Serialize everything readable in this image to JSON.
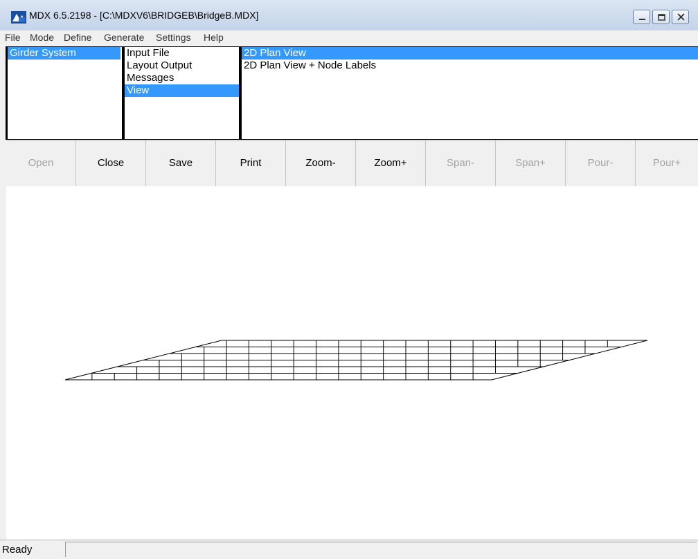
{
  "window": {
    "title": "MDX 6.5.2198 - [C:\\MDXV6\\BRIDGEB\\BridgeB.MDX]",
    "icon": "app-logo-icon",
    "buttons": [
      "minimize-icon",
      "restore-icon",
      "close-icon"
    ]
  },
  "menu": [
    "File",
    "Mode",
    "Define",
    "Generate",
    "Settings",
    "Help"
  ],
  "lists": {
    "systems": {
      "items": [
        "Girder System"
      ],
      "selected": "Girder System"
    },
    "outputs": {
      "items": [
        "Input File",
        "Layout Output",
        "Messages",
        "View"
      ],
      "selected": "View"
    },
    "views": {
      "items": [
        "2D Plan View",
        "2D Plan View + Node Labels"
      ],
      "selected": "2D Plan View"
    }
  },
  "toolbar": {
    "buttons": [
      {
        "label": "Open",
        "enabled": false
      },
      {
        "label": "Close",
        "enabled": true
      },
      {
        "label": "Save",
        "enabled": true
      },
      {
        "label": "Print",
        "enabled": true
      },
      {
        "label": "Zoom-",
        "enabled": true
      },
      {
        "label": "Zoom+",
        "enabled": true
      },
      {
        "label": "Span-",
        "enabled": false
      },
      {
        "label": "Span+",
        "enabled": false
      },
      {
        "label": "Pour-",
        "enabled": false
      },
      {
        "label": "Pour+",
        "enabled": false
      }
    ]
  },
  "status": {
    "text": "Ready"
  },
  "colors": {
    "selection": "#3399ff",
    "window_bg": "#f0f0f0"
  }
}
